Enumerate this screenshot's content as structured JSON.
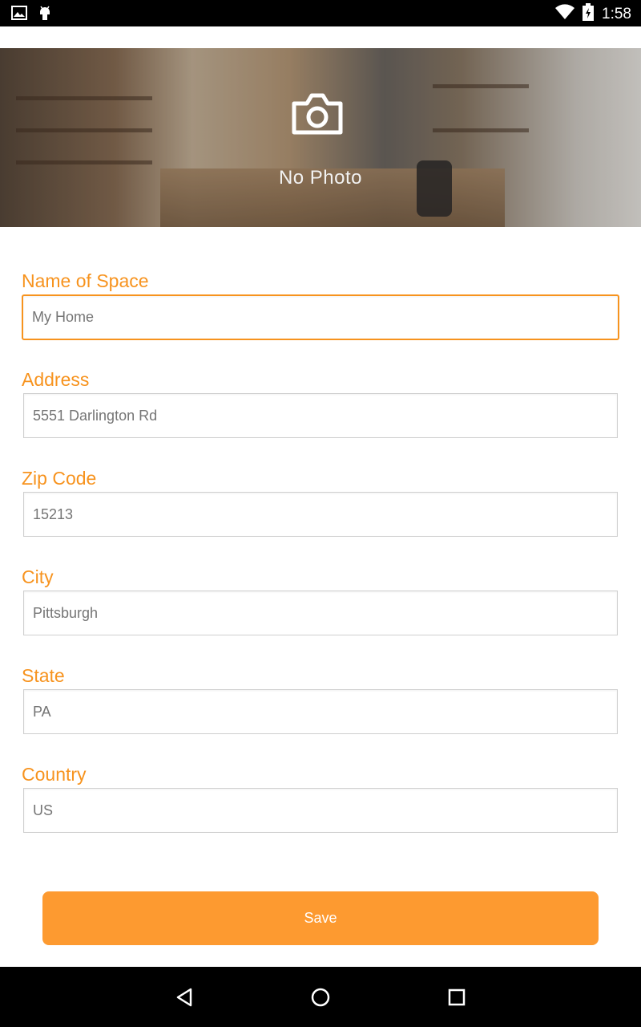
{
  "status_bar": {
    "time": "1:58",
    "icons": [
      "image-icon",
      "android-icon",
      "wifi-icon",
      "battery-icon"
    ]
  },
  "header": {
    "no_photo_label": "No Photo",
    "icon": "camera-icon"
  },
  "form": {
    "name": {
      "label": "Name of Space",
      "placeholder": "My Home",
      "value": ""
    },
    "address": {
      "label": "Address",
      "placeholder": "5551 Darlington Rd",
      "value": ""
    },
    "zip": {
      "label": "Zip Code",
      "placeholder": "15213",
      "value": ""
    },
    "city": {
      "label": "City",
      "placeholder": "Pittsburgh",
      "value": ""
    },
    "state": {
      "label": "State",
      "placeholder": "PA",
      "value": ""
    },
    "country": {
      "label": "Country",
      "placeholder": "US",
      "value": ""
    }
  },
  "save_button": {
    "label": "Save"
  },
  "nav_bar": {
    "buttons": [
      "back-icon",
      "home-icon",
      "recents-icon"
    ]
  },
  "colors": {
    "accent": "#f7931e",
    "button": "#fd9a30",
    "input_text": "#8a8a8a"
  }
}
